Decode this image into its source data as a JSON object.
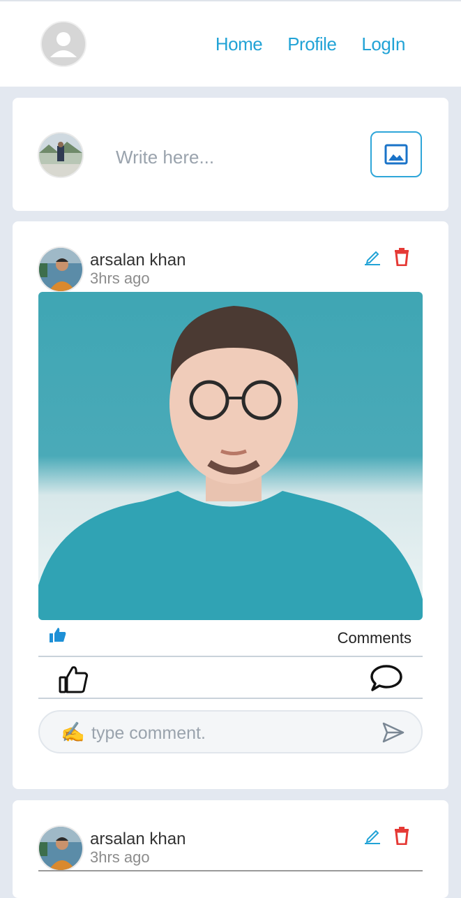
{
  "nav": {
    "links": [
      "Home",
      "Profile",
      "LogIn"
    ]
  },
  "composer": {
    "placeholder": "Write here..."
  },
  "posts": [
    {
      "author": "arsalan khan",
      "time": "3hrs ago",
      "comments_label": "Comments",
      "comment_placeholder": "type comment.",
      "comment_emoji": "✍️"
    },
    {
      "author": "arsalan khan",
      "time": "3hrs ago"
    }
  ],
  "colors": {
    "accent": "#22a3d6",
    "delete": "#e53935",
    "like": "#1e90d6",
    "background": "#e3e8f0"
  }
}
